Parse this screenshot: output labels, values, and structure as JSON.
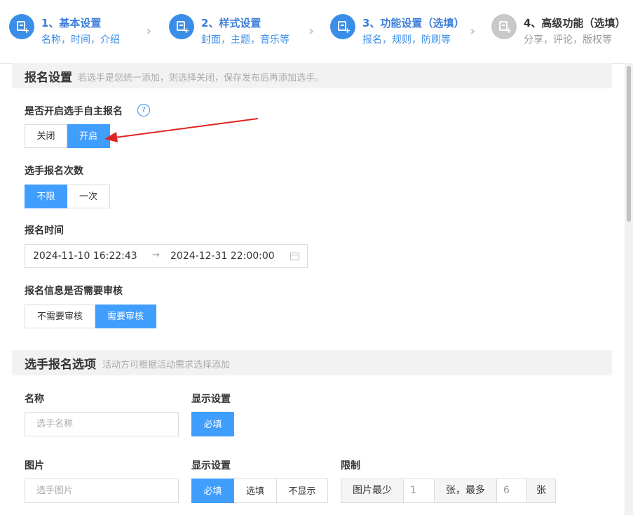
{
  "steps": [
    {
      "title": "1、基本设置",
      "sub": "名称，时间，介绍",
      "state": "done"
    },
    {
      "title": "2、样式设置",
      "sub": "封面，主题，音乐等",
      "state": "done"
    },
    {
      "title": "3、功能设置（选填）",
      "sub": "报名，规则，防刷等",
      "state": "active"
    },
    {
      "title": "4、高级功能（选填）",
      "sub": "分享，评论，版权等",
      "state": "inactive"
    }
  ],
  "signup_section": {
    "title": "报名设置",
    "hint": "若选手是您统一添加，则选择关闭，保存发布后再添加选手。",
    "self_signup": {
      "label": "是否开启选手自主报名",
      "help": "?",
      "options": [
        "关闭",
        "开启"
      ],
      "selected": "开启"
    },
    "signup_count": {
      "label": "选手报名次数",
      "options": [
        "不限",
        "一次"
      ],
      "selected": "不限"
    },
    "signup_time": {
      "label": "报名时间",
      "start": "2024-11-10 16:22:43",
      "arrow": "→",
      "end": "2024-12-31 22:00:00"
    },
    "review": {
      "label": "报名信息是否需要审核",
      "options": [
        "不需要审核",
        "需要审核"
      ],
      "selected": "需要审核"
    }
  },
  "options_section": {
    "title": "选手报名选项",
    "hint": "活动方可根据活动需求选择添加",
    "name_field": {
      "label": "名称",
      "placeholder": "选手名称",
      "display_label": "显示设置",
      "display_options": [
        "必填"
      ],
      "selected": "必填"
    },
    "image_field": {
      "label": "图片",
      "placeholder": "选手图片",
      "display_label": "显示设置",
      "display_options": [
        "必填",
        "选填",
        "不显示"
      ],
      "selected": "必填",
      "limit_label": "限制",
      "min_prefix": "图片最少",
      "min_value": "1",
      "mid_text": "张，最多",
      "max_value": "6",
      "suffix": "张"
    }
  },
  "colors": {
    "primary": "#409eff",
    "step_active": "#3b8ee8",
    "annotation_arrow": "#e02424"
  }
}
